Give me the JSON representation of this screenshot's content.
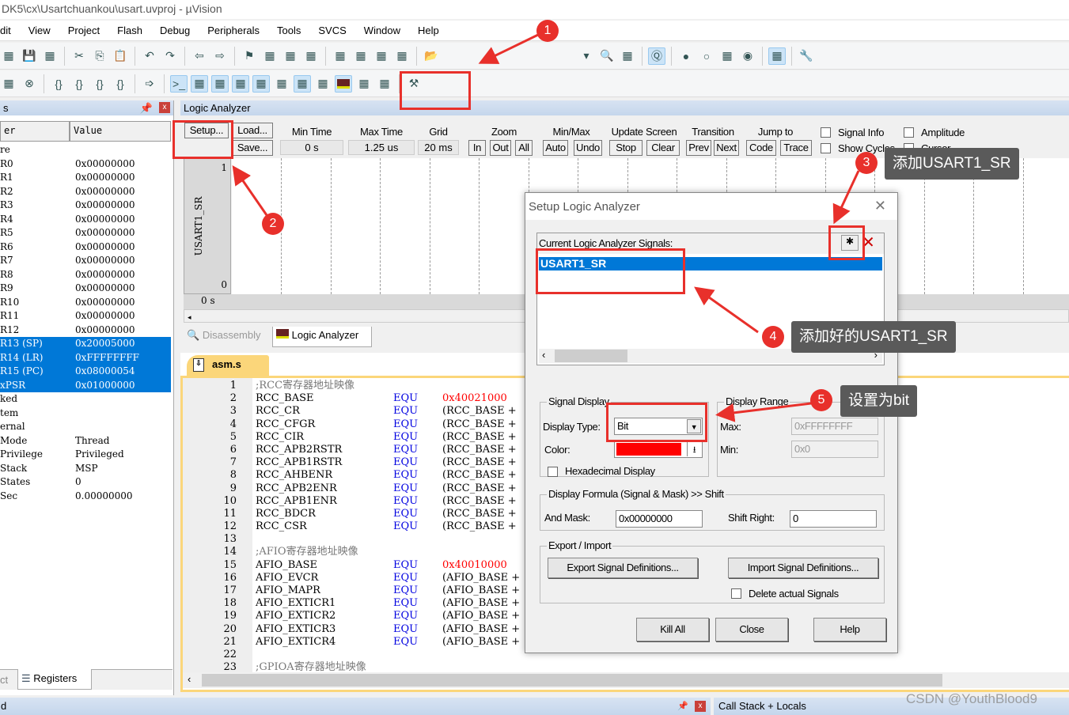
{
  "window": {
    "title": "DK5\\cx\\Usartchuankou\\usart.uvproj - µVision"
  },
  "menu": [
    "dit",
    "View",
    "Project",
    "Flash",
    "Debug",
    "Peripherals",
    "Tools",
    "SVCS",
    "Window",
    "Help"
  ],
  "toolbar1": [
    "new-file-icon",
    "save-icon",
    "save-all-icon",
    "|",
    "cut-icon",
    "copy-icon",
    "paste-icon",
    "|",
    "undo-icon",
    "redo-icon",
    "|",
    "back-icon",
    "forward-icon",
    "|",
    "bookmark-icon",
    "prev-bookmark-icon",
    "next-bookmark-icon",
    "clear-bookmarks-icon",
    "|",
    "indent-icon",
    "unindent-icon",
    "comment-icon",
    "uncomment-icon",
    "|",
    "open-project-icon"
  ],
  "toolbar1_right": [
    "dropdown-icon",
    "find-icon",
    "debug-settings-icon",
    "|",
    "start-debug-icon",
    "|",
    "breakpoint-icon",
    "disable-breakpoint-icon",
    "kill-breakpoints-icon",
    "record-icon",
    "|",
    "window-layout-icon",
    "|",
    "settings-wrench-icon"
  ],
  "toolbar2": [
    "register-window-icon",
    "reset-icon",
    "|",
    "step-into-icon",
    "step-over-icon",
    "step-out-icon",
    "run-to-cursor-icon",
    "|",
    "show-next-statement-icon",
    "|",
    "command-window-icon",
    "disassembly-window-icon",
    "symbols-window-icon",
    "registers-window-icon",
    "call-stack-icon",
    "watch-window-icon",
    "memory-window-icon",
    "serial-window-icon",
    "logic-analyzer-icon",
    "system-viewer-icon",
    "toolbox-icon",
    "|",
    "tools-icon"
  ],
  "registers": {
    "panel_title": "s",
    "columns": [
      "er",
      "Value"
    ],
    "rows": [
      {
        "name": "re",
        "value": "",
        "sel": false
      },
      {
        "name": "R0",
        "value": "0x00000000",
        "sel": false
      },
      {
        "name": "R1",
        "value": "0x00000000",
        "sel": false
      },
      {
        "name": "R2",
        "value": "0x00000000",
        "sel": false
      },
      {
        "name": "R3",
        "value": "0x00000000",
        "sel": false
      },
      {
        "name": "R4",
        "value": "0x00000000",
        "sel": false
      },
      {
        "name": "R5",
        "value": "0x00000000",
        "sel": false
      },
      {
        "name": "R6",
        "value": "0x00000000",
        "sel": false
      },
      {
        "name": "R7",
        "value": "0x00000000",
        "sel": false
      },
      {
        "name": "R8",
        "value": "0x00000000",
        "sel": false
      },
      {
        "name": "R9",
        "value": "0x00000000",
        "sel": false
      },
      {
        "name": "R10",
        "value": "0x00000000",
        "sel": false
      },
      {
        "name": "R11",
        "value": "0x00000000",
        "sel": false
      },
      {
        "name": "R12",
        "value": "0x00000000",
        "sel": false
      },
      {
        "name": "R13 (SP)",
        "value": "0x20005000",
        "sel": true
      },
      {
        "name": "R14 (LR)",
        "value": "0xFFFFFFFF",
        "sel": true
      },
      {
        "name": "R15 (PC)",
        "value": "0x08000054",
        "sel": true
      },
      {
        "name": "xPSR",
        "value": "0x01000000",
        "sel": true
      },
      {
        "name": "ked",
        "value": "",
        "sel": false
      },
      {
        "name": "tem",
        "value": "",
        "sel": false
      },
      {
        "name": "ernal",
        "value": "",
        "sel": false
      },
      {
        "name": "Mode",
        "value": "Thread",
        "sel": false
      },
      {
        "name": "Privilege",
        "value": "Privileged",
        "sel": false
      },
      {
        "name": "Stack",
        "value": "MSP",
        "sel": false
      },
      {
        "name": "States",
        "value": "0",
        "sel": false
      },
      {
        "name": "Sec",
        "value": "0.00000000",
        "sel": false
      }
    ],
    "tabs": {
      "project": "ct",
      "registers": "Registers"
    }
  },
  "logic": {
    "title": "Logic Analyzer",
    "setup": "Setup...",
    "load": "Load...",
    "save": "Save...",
    "min_time_label": "Min Time",
    "min_time": "0 s",
    "max_time_label": "Max Time",
    "max_time": "1.25 us",
    "grid_label": "Grid",
    "grid": "20 ms",
    "zoom_label": "Zoom",
    "zoom_in": "In",
    "zoom_out": "Out",
    "zoom_all": "All",
    "minmax_label": "Min/Max",
    "auto": "Auto",
    "undo": "Undo",
    "update_label": "Update Screen",
    "stop": "Stop",
    "clear": "Clear",
    "transition_label": "Transition",
    "prev": "Prev",
    "next": "Next",
    "jump_label": "Jump to",
    "code": "Code",
    "trace": "Trace",
    "signal_info": "Signal Info",
    "show_cycles": "Show Cycles",
    "amplitude": "Amplitude",
    "cursor": "Cursor",
    "signal_name": "USART1_SR",
    "y_high": "1",
    "y_low": "0",
    "time_zero": "0 s",
    "tab_disassembly": "Disassembly",
    "tab_logic": "Logic Analyzer"
  },
  "editor": {
    "tab": "asm.s",
    "lines": [
      {
        "n": "1",
        "comment": ";RCC寄存器地址映像"
      },
      {
        "n": "2",
        "label": "RCC_BASE",
        "op": "EQU",
        "val": "0x40021000",
        "red": true
      },
      {
        "n": "3",
        "label": "RCC_CR",
        "op": "EQU",
        "val": "(RCC_BASE +"
      },
      {
        "n": "4",
        "label": "RCC_CFGR",
        "op": "EQU",
        "val": "(RCC_BASE +"
      },
      {
        "n": "5",
        "label": "RCC_CIR",
        "op": "EQU",
        "val": "(RCC_BASE +"
      },
      {
        "n": "6",
        "label": "RCC_APB2RSTR",
        "op": "EQU",
        "val": "(RCC_BASE +"
      },
      {
        "n": "7",
        "label": "RCC_APB1RSTR",
        "op": "EQU",
        "val": "(RCC_BASE +"
      },
      {
        "n": "8",
        "label": "RCC_AHBENR",
        "op": "EQU",
        "val": "(RCC_BASE +"
      },
      {
        "n": "9",
        "label": "RCC_APB2ENR",
        "op": "EQU",
        "val": "(RCC_BASE +"
      },
      {
        "n": "10",
        "label": "RCC_APB1ENR",
        "op": "EQU",
        "val": "(RCC_BASE +"
      },
      {
        "n": "11",
        "label": "RCC_BDCR",
        "op": "EQU",
        "val": "(RCC_BASE +"
      },
      {
        "n": "12",
        "label": "RCC_CSR",
        "op": "EQU",
        "val": "(RCC_BASE +"
      },
      {
        "n": "13"
      },
      {
        "n": "14",
        "comment": ";AFIO寄存器地址映像"
      },
      {
        "n": "15",
        "label": "AFIO_BASE",
        "op": "EQU",
        "val": "0x40010000",
        "red": true
      },
      {
        "n": "16",
        "label": "AFIO_EVCR",
        "op": "EQU",
        "val": "(AFIO_BASE +"
      },
      {
        "n": "17",
        "label": "AFIO_MAPR",
        "op": "EQU",
        "val": "(AFIO_BASE +"
      },
      {
        "n": "18",
        "label": "AFIO_EXTICR1",
        "op": "EQU",
        "val": "(AFIO_BASE +"
      },
      {
        "n": "19",
        "label": "AFIO_EXTICR2",
        "op": "EQU",
        "val": "(AFIO_BASE +"
      },
      {
        "n": "20",
        "label": "AFIO_EXTICR3",
        "op": "EQU",
        "val": "(AFIO_BASE +"
      },
      {
        "n": "21",
        "label": "AFIO_EXTICR4",
        "op": "EQU",
        "val": "(AFIO_BASE +"
      },
      {
        "n": "22"
      },
      {
        "n": "23",
        "comment": ";GPIOA寄存器地址映像"
      }
    ]
  },
  "dialog": {
    "title": "Setup Logic Analyzer",
    "signals_label": "Current Logic Analyzer Signals:",
    "signals": [
      "USART1_SR"
    ],
    "signal_display": "Signal Display",
    "display_type_label": "Display Type:",
    "display_type": "Bit",
    "color_label": "Color:",
    "color": "#ff0000",
    "hex_display": "Hexadecimal Display",
    "display_range": "Display Range",
    "max_label": "Max:",
    "max": "0xFFFFFFFF",
    "min_label": "Min:",
    "min": "0x0",
    "formula": "Display Formula (Signal & Mask) >> Shift",
    "and_mask_label": "And Mask:",
    "and_mask": "0x00000000",
    "shift_right_label": "Shift Right:",
    "shift_right": "0",
    "export_import": "Export / Import",
    "export": "Export Signal Definitions...",
    "import": "Import Signal Definitions...",
    "delete_actual": "Delete actual Signals",
    "kill_all": "Kill All",
    "close": "Close",
    "help": "Help"
  },
  "bottom": {
    "left_title": "d",
    "right_title": "Call Stack + Locals"
  },
  "annotations": {
    "badges": [
      "1",
      "2",
      "3",
      "4",
      "5"
    ],
    "callout3": "添加USART1_SR",
    "callout4": "添加好的USART1_SR",
    "callout5": "设置为bit",
    "watermark": "CSDN @YouthBlood9",
    "color": "#e8302b"
  }
}
